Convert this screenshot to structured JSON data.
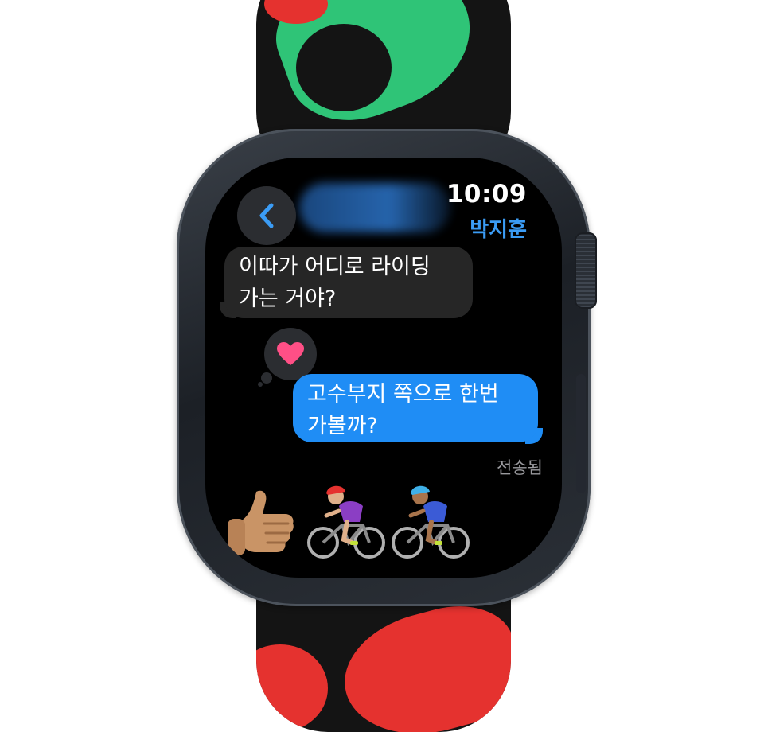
{
  "watch": {
    "time": "10:09",
    "contact_name": "박지훈"
  },
  "conversation": {
    "received_message": {
      "line1": "이따가 어디로 라이딩",
      "line2": "가는 거야?"
    },
    "sent_message": {
      "line1": "고수부지 쪽으로 한번",
      "line2": "가볼까?"
    },
    "tapback": "heart-icon",
    "delivery_status": "전송됨"
  },
  "reply_emojis": [
    "thumbs-up-icon",
    "woman-biking-icon",
    "man-biking-icon"
  ],
  "colors": {
    "incoming_bubble": "#262626",
    "outgoing_bubble": "#1f8df5",
    "accent": "#3b9cf5",
    "heart": "#ff4f86",
    "band_green": "#2fc477",
    "band_red": "#e5322f"
  }
}
